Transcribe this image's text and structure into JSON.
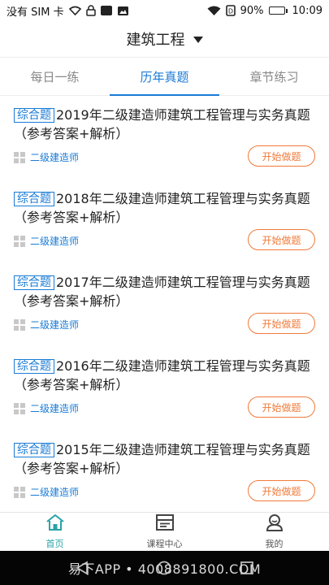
{
  "status_bar": {
    "carrier": "没有 SIM 卡",
    "battery": "90%",
    "battery_level": 0.9,
    "time": "10:09"
  },
  "header": {
    "title": "建筑工程"
  },
  "tabs": [
    {
      "label": "每日一练",
      "active": false
    },
    {
      "label": "历年真题",
      "active": true
    },
    {
      "label": "章节练习",
      "active": false
    }
  ],
  "items": [
    {
      "tag": "综合题",
      "title": "2019年二级建造师建筑工程管理与实务真题（参考答案+解析）",
      "category": "二级建造师",
      "button": "开始做题"
    },
    {
      "tag": "综合题",
      "title": "2018年二级建造师建筑工程管理与实务真题（参考答案+解析）",
      "category": "二级建造师",
      "button": "开始做题"
    },
    {
      "tag": "综合题",
      "title": "2017年二级建造师建筑工程管理与实务真题（参考答案+解析）",
      "category": "二级建造师",
      "button": "开始做题"
    },
    {
      "tag": "综合题",
      "title": "2016年二级建造师建筑工程管理与实务真题（参考答案+解析）",
      "category": "二级建造师",
      "button": "开始做题"
    },
    {
      "tag": "综合题",
      "title": "2015年二级建造师建筑工程管理与实务真题（参考答案+解析）",
      "category": "二级建造师",
      "button": "开始做题"
    }
  ],
  "bottom_nav": [
    {
      "label": "首页",
      "icon": "home-icon",
      "active": true
    },
    {
      "label": "课程中心",
      "icon": "course-center-icon",
      "active": false
    },
    {
      "label": "我的",
      "icon": "profile-icon",
      "active": false
    }
  ],
  "watermark": "易下APP • 4008891800.COM",
  "colors": {
    "accent_blue": "#1a7bd6",
    "button_orange": "#f07a3a",
    "nav_active_teal": "#2aa3a8"
  }
}
